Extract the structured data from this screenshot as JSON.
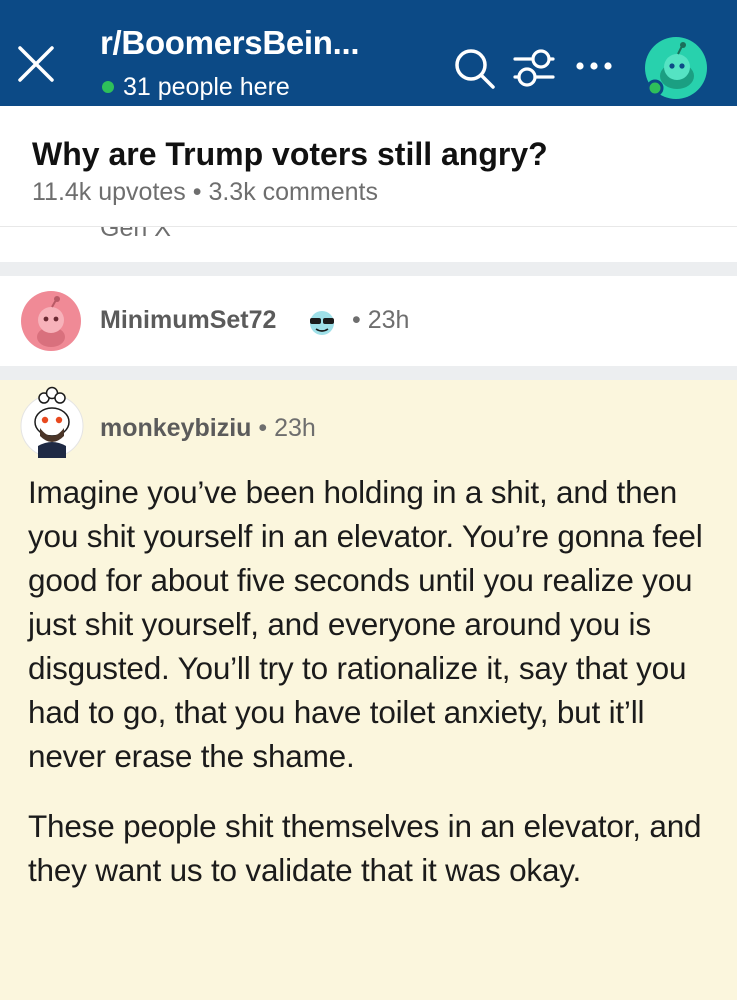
{
  "header": {
    "subreddit": "r/BoomersBein...",
    "online": "31 people here",
    "icons": [
      "close-icon",
      "search-icon",
      "filter-icon",
      "more-icon",
      "avatar"
    ]
  },
  "post": {
    "title": "Why are Trump voters still angry?",
    "meta": "11.4k upvotes • 3.3k comments"
  },
  "partial_comment": {
    "flair": "Gen X"
  },
  "collapsed_comment": {
    "username": "MinimumSet72",
    "time": "• 23h"
  },
  "comment": {
    "username": "monkeybiziu",
    "time": " • 23h",
    "paragraphs": [
      "Imagine you’ve been holding in a shit, and then you shit yourself in an elevator. You’re gonna feel good for about five seconds until you realize you just shit yourself, and everyone around you is disgusted. You’ll try to rationalize it, say that you had to go, that you have toilet anxiety, but it’ll never erase the shame.",
      "These people shit themselves in an elevator, and they want us to validate that it was okay."
    ]
  },
  "colors": {
    "nav": "#0c4a86",
    "online": "#2ec05a",
    "highlight": "#fbf6dd",
    "avatar_teal": "#28d1ad",
    "avatar_pink": "#f08a96"
  }
}
